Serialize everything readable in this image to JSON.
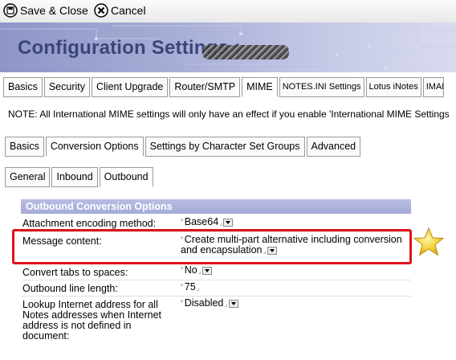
{
  "toolbar": {
    "save_close": "Save & Close",
    "cancel": "Cancel"
  },
  "banner": {
    "title": "Configuration Settings :"
  },
  "main_tabs": [
    "Basics",
    "Security",
    "Client Upgrade",
    "Router/SMTP",
    "MIME",
    "NOTES.INI Settings",
    "Lotus iNotes",
    "IMAP"
  ],
  "note": "NOTE: All International MIME settings will only have an effect if you enable 'International MIME Settings",
  "mime_tabs": [
    "Basics",
    "Conversion Options",
    "Settings by Character Set Groups",
    "Advanced"
  ],
  "conv_tabs": [
    "General",
    "Inbound",
    "Outbound"
  ],
  "section": {
    "header": "Outbound Conversion Options"
  },
  "fields": {
    "attachment_label": "Attachment encoding method:",
    "attachment_value": "Base64",
    "message_label": "Message content:",
    "message_value_line1": "Create multi-part alternative including conversion",
    "message_value_line2": "and encapsulation",
    "tabs_label": "Convert tabs to spaces:",
    "tabs_value": "No",
    "linelen_label": "Outbound line length:",
    "linelen_value": "75",
    "lookup_label_1": "Lookup Internet address for all",
    "lookup_label_2": "Notes addresses when Internet",
    "lookup_label_3": "address is not defined in",
    "lookup_label_4": "document:",
    "lookup_value": "Disabled"
  },
  "colors": {
    "highlight": "#e0121c",
    "banner": "#a8aed6",
    "section_header": "#b0b4de"
  },
  "icons": {
    "save": "save-disk-icon",
    "cancel": "cancel-x-icon",
    "star": "star-icon"
  }
}
